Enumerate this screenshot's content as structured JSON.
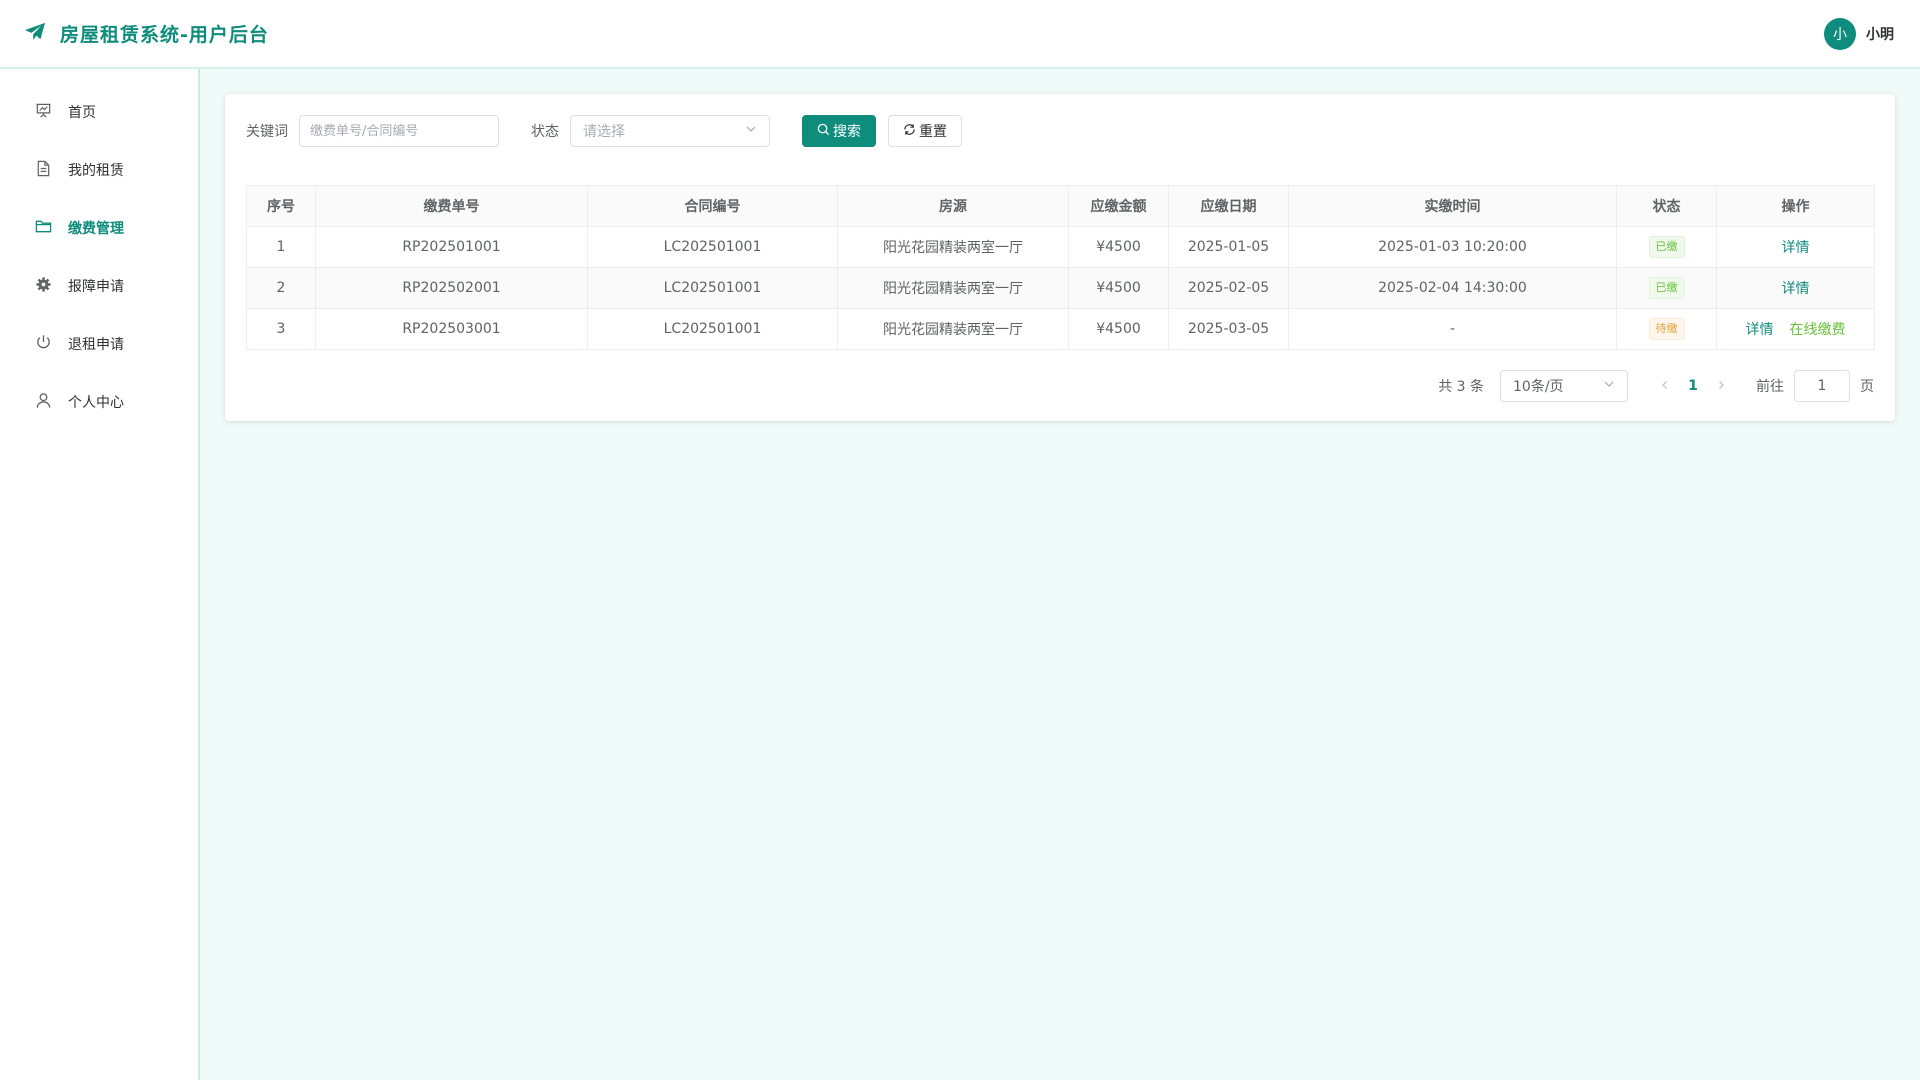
{
  "header": {
    "title": "房屋租赁系统-用户后台",
    "user_avatar": "小",
    "user_name": "小明",
    "brand_icon": "paper-plane-icon"
  },
  "colors": {
    "accent": "#0e8c7c",
    "success": "#67c23a",
    "warning": "#e6a23c",
    "background": "#f0fbf9"
  },
  "sidebar": {
    "items": [
      {
        "label": "首页",
        "icon": "presentation-chart-icon",
        "active": false
      },
      {
        "label": "我的租赁",
        "icon": "document-icon",
        "active": false
      },
      {
        "label": "缴费管理",
        "icon": "folder-icon",
        "active": true
      },
      {
        "label": "报障申请",
        "icon": "gear-icon",
        "active": false
      },
      {
        "label": "退租申请",
        "icon": "power-icon",
        "active": false
      },
      {
        "label": "个人中心",
        "icon": "user-icon",
        "active": false
      }
    ]
  },
  "filters": {
    "keyword_label": "关键词",
    "keyword_placeholder": "缴费单号/合同编号",
    "status_label": "状态",
    "status_placeholder": "请选择",
    "search_label": "搜索",
    "reset_label": "重置"
  },
  "table": {
    "headers": [
      "序号",
      "缴费单号",
      "合同编号",
      "房源",
      "应缴金额",
      "应缴日期",
      "实缴时间",
      "状态",
      "操作"
    ],
    "rows": [
      {
        "index": "1",
        "bill_no": "RP202501001",
        "contract_no": "LC202501001",
        "property": "阳光花园精装两室一厅",
        "amount": "¥4500",
        "due_date": "2025-01-05",
        "paid_time": "2025-01-03 10:20:00",
        "status": "已缴",
        "status_type": "paid",
        "actions": [
          "详情"
        ]
      },
      {
        "index": "2",
        "bill_no": "RP202502001",
        "contract_no": "LC202501001",
        "property": "阳光花园精装两室一厅",
        "amount": "¥4500",
        "due_date": "2025-02-05",
        "paid_time": "2025-02-04 14:30:00",
        "status": "已缴",
        "status_type": "paid",
        "actions": [
          "详情"
        ]
      },
      {
        "index": "3",
        "bill_no": "RP202503001",
        "contract_no": "LC202501001",
        "property": "阳光花园精装两室一厅",
        "amount": "¥4500",
        "due_date": "2025-03-05",
        "paid_time": "-",
        "status": "待缴",
        "status_type": "pending",
        "actions": [
          "详情",
          "在线缴费"
        ]
      }
    ]
  },
  "pagination": {
    "total_text": "共 3 条",
    "page_size": "10条/页",
    "current_page": "1",
    "goto_label": "前往",
    "goto_value": "1",
    "page_unit": "页"
  }
}
